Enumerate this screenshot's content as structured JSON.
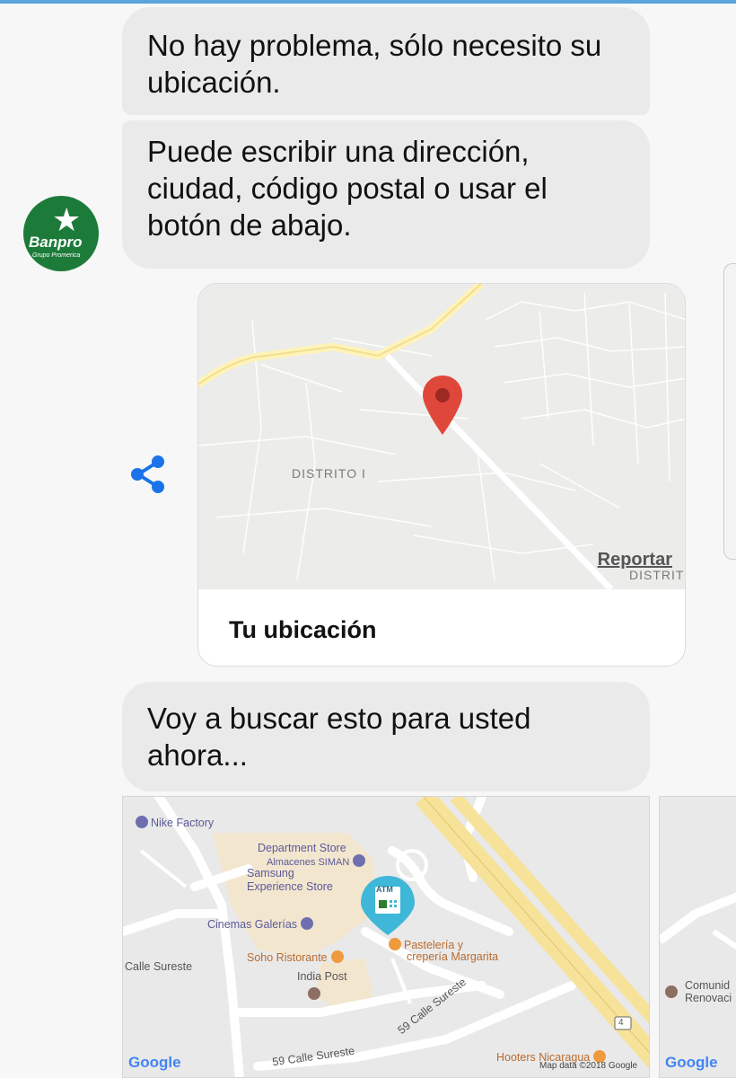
{
  "messages": {
    "m1": "No hay problema, sólo necesito su ubicación.",
    "m2": "Puede escribir una dirección, ciudad, código postal o usar el botón de abajo.",
    "m3": "Voy a buscar esto para usted ahora..."
  },
  "avatar": {
    "name": "Banpro",
    "subtitle": "Grupo Promerica",
    "icon": "star-logo-icon"
  },
  "location_card": {
    "title": "Tu ubicación",
    "map_label_1": "DISTRITO I",
    "map_label_2": "DISTRITO",
    "report_link": "Reportar"
  },
  "result_map": {
    "pois": {
      "nike": "Nike Factory",
      "dept1": "Department Store",
      "dept2": "Almacenes SIMAN",
      "samsung1": "Samsung",
      "samsung2": "Experience Store",
      "cinemas": "Cinemas Galerías",
      "soho": "Soho Ristorante",
      "pasteleria1": "Pastelería y",
      "pasteleria2": "crepería Margarita",
      "indiapost": "India Post",
      "street1": "Calle Sureste",
      "street2": "59 Calle Sureste",
      "street3": "59 Calle Sureste",
      "hooters": "Hooters Nicaragua",
      "atm": "ATM",
      "route": "4"
    },
    "google": "Google",
    "map_data": "Map data ©2018 Google"
  },
  "second_map": {
    "poi1": "Comunid",
    "poi2": "Renovaci",
    "google": "Google"
  },
  "colors": {
    "accent": "#1a73e8",
    "brand_green": "#1d7b3a",
    "pin_red": "#e0473b",
    "atm_teal": "#3fb7d8"
  }
}
